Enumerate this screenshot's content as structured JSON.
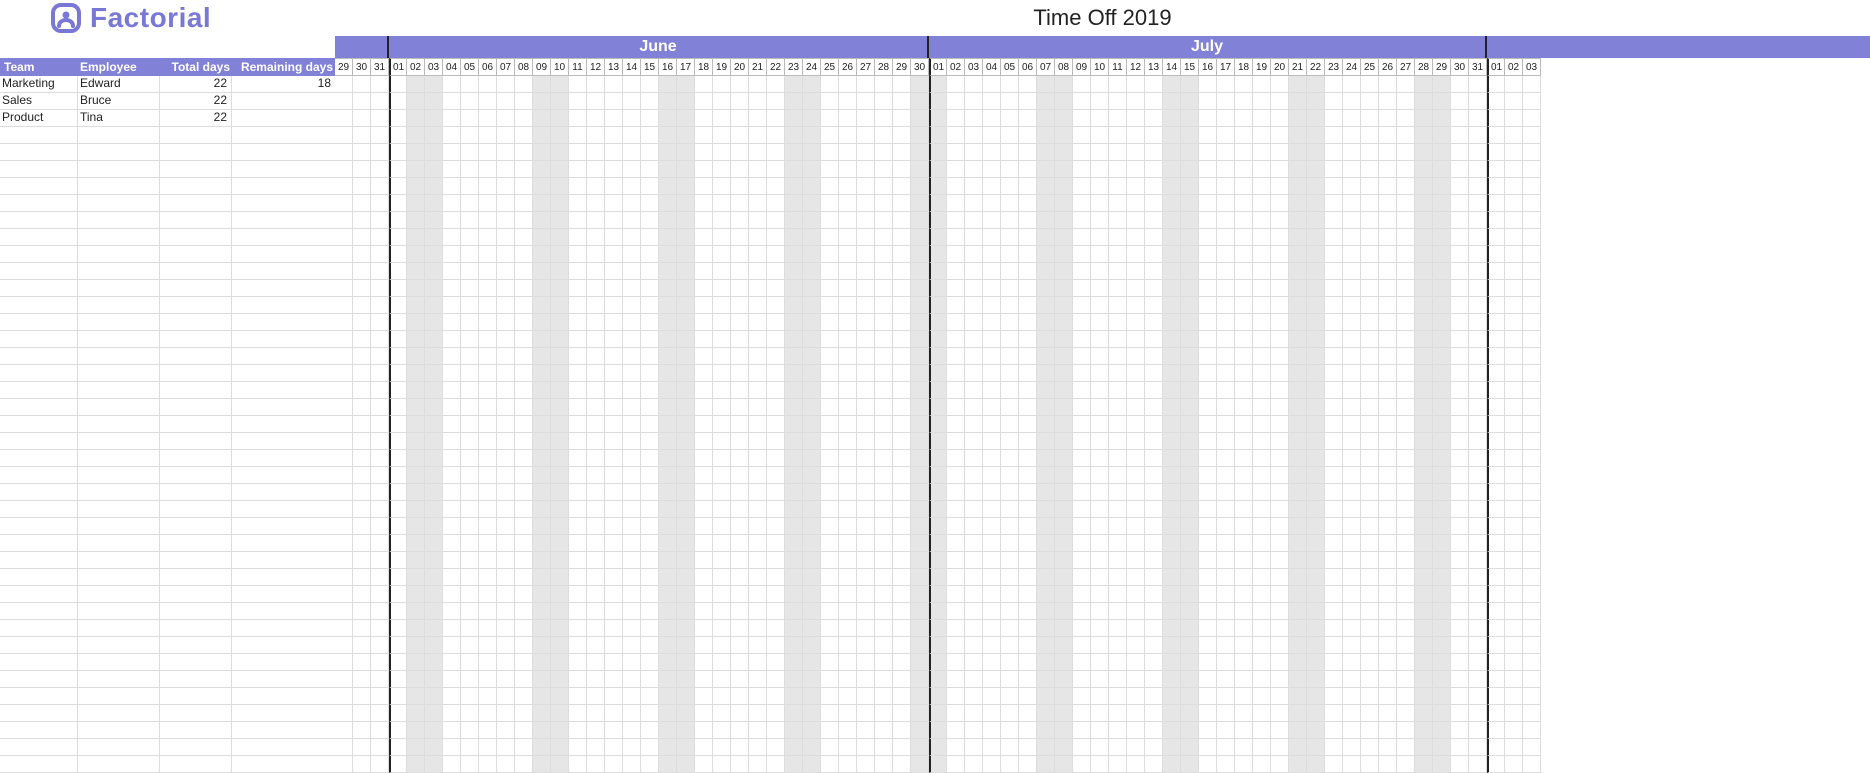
{
  "brand": {
    "name": "Factorial"
  },
  "page_title": "Time Off 2019",
  "columns": {
    "team": "Team",
    "employee": "Employee",
    "total_days": "Total days",
    "remaining_days": "Remaining days"
  },
  "months": [
    {
      "name": "June",
      "days": 30
    },
    {
      "name": "July",
      "days": 31
    }
  ],
  "lead_days": [
    "29",
    "30",
    "31"
  ],
  "tail_days": [
    "01",
    "02",
    "03"
  ],
  "employees": [
    {
      "team": "Marketing",
      "name": "Edward",
      "total": "22",
      "remaining": "18"
    },
    {
      "team": "Sales",
      "name": "Bruce",
      "total": "22",
      "remaining": ""
    },
    {
      "team": "Product",
      "name": "Tina",
      "total": "22",
      "remaining": ""
    }
  ],
  "shaded_day_indices": [
    4,
    5,
    11,
    12,
    18,
    19,
    25,
    26,
    32,
    33,
    39,
    40,
    46,
    47,
    53,
    54,
    60,
    61,
    67,
    68,
    74,
    75,
    81,
    82
  ],
  "month_start_indices": [
    3,
    33,
    64
  ],
  "empty_rows": 38
}
